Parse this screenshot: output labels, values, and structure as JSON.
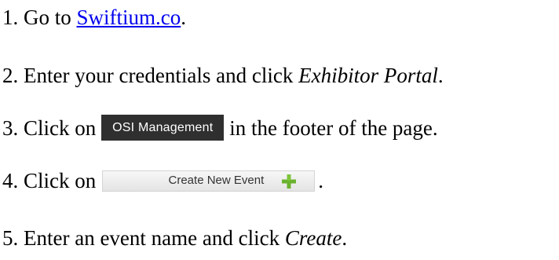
{
  "steps": [
    {
      "number": "1.",
      "before": "Go to",
      "link": "Swiftium.co",
      "after": "."
    },
    {
      "number": "2.",
      "before": "Enter your credentials and click",
      "emphasis": "Exhibitor Portal",
      "after": "."
    },
    {
      "number": "3.",
      "before": "Click on",
      "button_label": "OSI Management",
      "after": "in the footer of the page."
    },
    {
      "number": "4.",
      "before": "Click on",
      "button_label": "Create New Event",
      "button_icon": "plus-icon",
      "after": "."
    },
    {
      "number": "5.",
      "before": "Enter an event name and click",
      "emphasis": "Create",
      "after": "."
    }
  ],
  "colors": {
    "link": "#0000ee",
    "osi_button_bg": "#2f2f2f",
    "osi_button_text": "#ffffff",
    "create_button_bg": "#ececec",
    "plus_icon": "#6bb32e"
  }
}
